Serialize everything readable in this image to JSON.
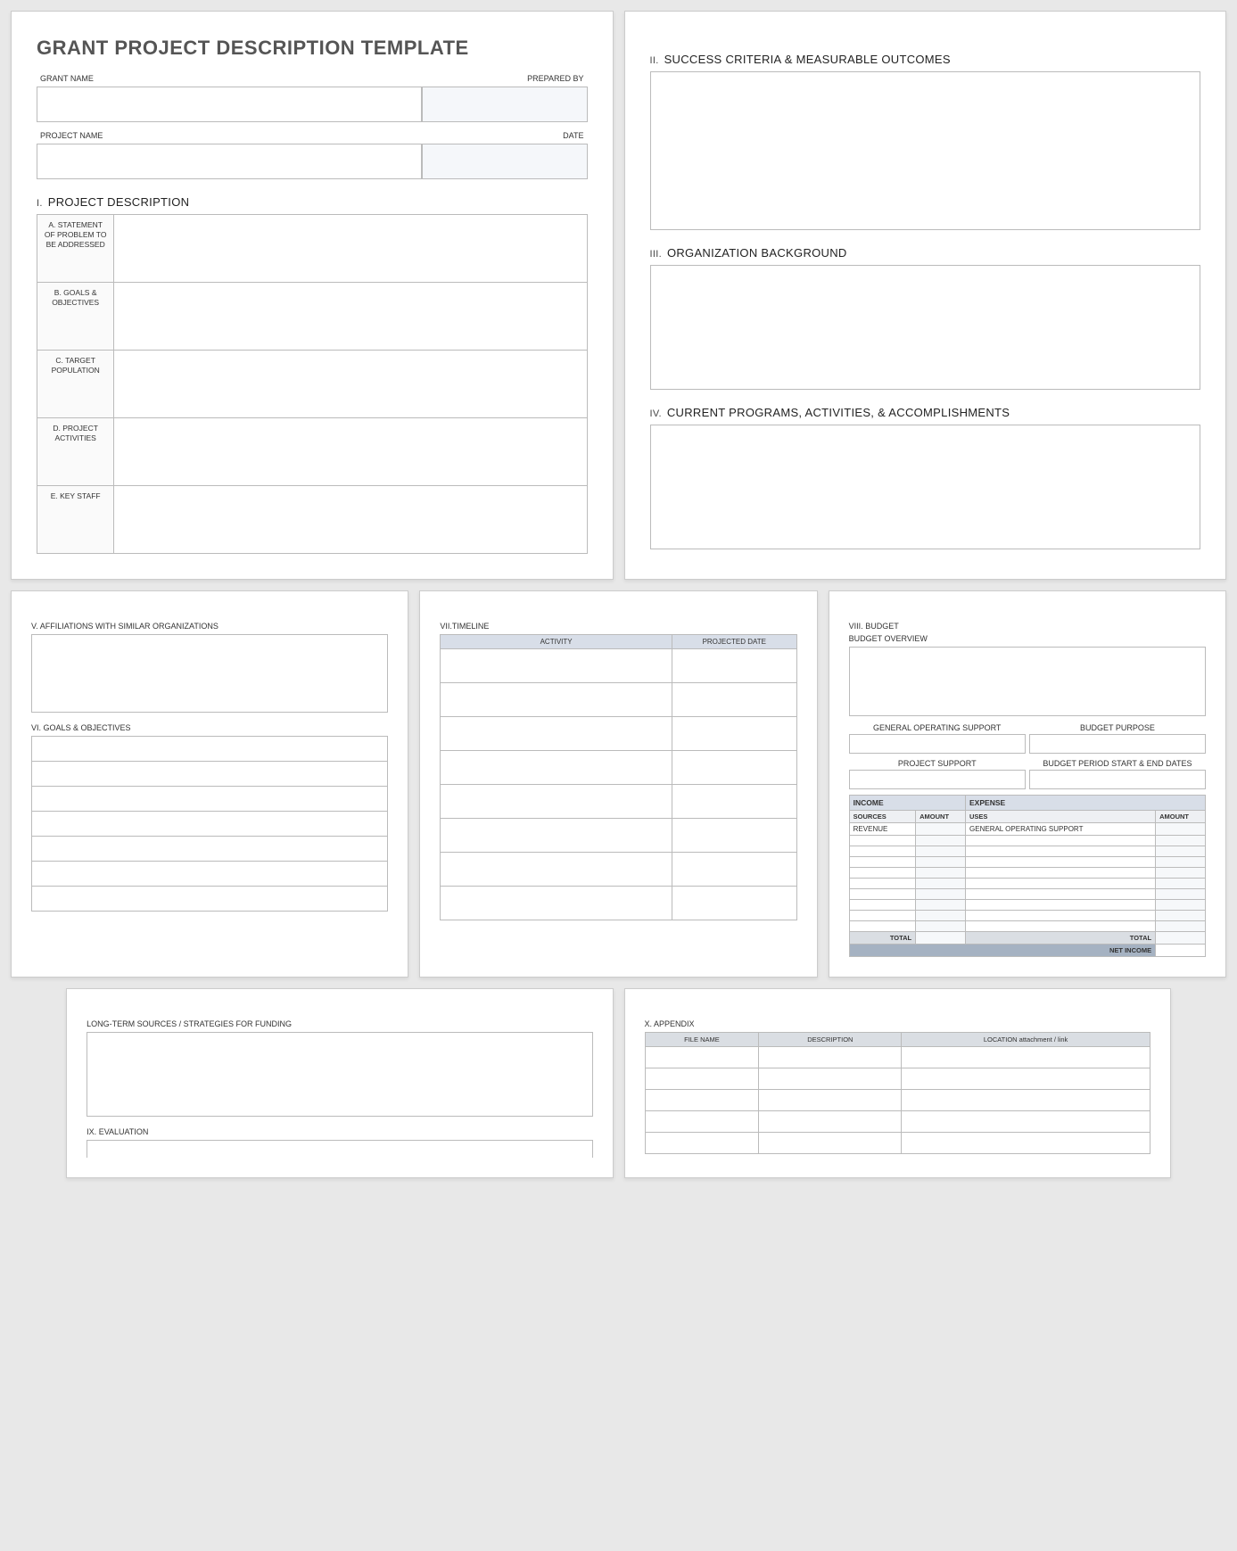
{
  "page_title": "GRANT PROJECT DESCRIPTION TEMPLATE",
  "info": {
    "grant_name": "GRANT NAME",
    "prepared_by": "PREPARED BY",
    "project_name": "PROJECT NAME",
    "date": "DATE"
  },
  "sections": {
    "s1_num": "I.",
    "s1": "PROJECT DESCRIPTION",
    "pd": {
      "a": "A.  STATEMENT OF PROBLEM TO BE ADDRESSED",
      "b": "B.  GOALS & OBJECTIVES",
      "c": "C.  TARGET POPULATION",
      "d": "D.  PROJECT ACTIVITIES",
      "e": "E.  KEY STAFF"
    },
    "s2_num": "II.",
    "s2": "SUCCESS CRITERIA & MEASURABLE OUTCOMES",
    "s3_num": "III.",
    "s3": "ORGANIZATION BACKGROUND",
    "s4_num": "IV.",
    "s4": "CURRENT PROGRAMS, ACTIVITIES, & ACCOMPLISHMENTS",
    "s5_num": "V.",
    "s5": "AFFILIATIONS WITH SIMILAR ORGANIZATIONS",
    "s6_num": "VI.",
    "s6": "GOALS & OBJECTIVES",
    "s7_num": "VII.",
    "s7": "TIMELINE",
    "tl_activity": "ACTIVITY",
    "tl_date": "PROJECTED DATE",
    "s8_num": "VIII.",
    "s8": "BUDGET",
    "bud_overview": "BUDGET OVERVIEW",
    "bud_gos": "GENERAL OPERATING SUPPORT",
    "bud_purpose": "BUDGET PURPOSE",
    "bud_ps": "PROJECT SUPPORT",
    "bud_period": "BUDGET PERIOD START & END DATES",
    "bud_income": "INCOME",
    "bud_expense": "EXPENSE",
    "bud_sources": "SOURCES",
    "bud_amount": "AMOUNT",
    "bud_uses": "USES",
    "bud_revenue": "REVENUE",
    "bud_gos2": "GENERAL OPERATING SUPPORT",
    "bud_total": "TOTAL",
    "bud_net": "NET INCOME",
    "lts": "LONG-TERM SOURCES / STRATEGIES FOR FUNDING",
    "s9_num": "IX.",
    "s9": "EVALUATION",
    "s10_num": "X.",
    "s10": "APPENDIX",
    "apx_file": "FILE NAME",
    "apx_desc": "DESCRIPTION",
    "apx_loc": "LOCATION attachment / link"
  }
}
